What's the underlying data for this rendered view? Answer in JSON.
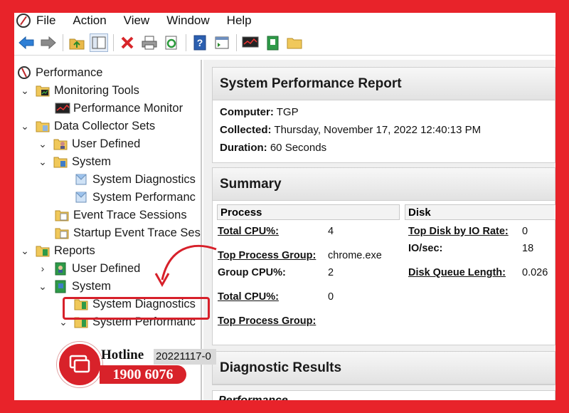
{
  "menu": [
    "File",
    "Action",
    "View",
    "Window",
    "Help"
  ],
  "toolbar": [
    "back-icon",
    "forward-icon",
    "up-folder-icon",
    "show-hide-tree-icon",
    "delete-icon",
    "print-icon",
    "refresh-icon",
    "help-icon",
    "properties-icon",
    "monitor-icon",
    "book-icon",
    "folder-icon"
  ],
  "tree": {
    "items": [
      {
        "label": "Performance"
      },
      {
        "label": "Monitoring Tools"
      },
      {
        "label": "Performance Monitor"
      },
      {
        "label": "Data Collector Sets"
      },
      {
        "label": "User Defined"
      },
      {
        "label": "System"
      },
      {
        "label": "System Diagnostics"
      },
      {
        "label": "System Performanc"
      },
      {
        "label": "Event Trace Sessions"
      },
      {
        "label": "Startup Event Trace Ses"
      },
      {
        "label": "Reports"
      },
      {
        "label": "User Defined"
      },
      {
        "label": "System"
      },
      {
        "label": "System Diagnostics"
      },
      {
        "label": "System Performanc"
      },
      {
        "label": "20221117-0"
      }
    ]
  },
  "report": {
    "title": "System Performance Report",
    "computer_label": "Computer:",
    "computer_value": "TGP",
    "collected_label": "Collected:",
    "collected_value": "Thursday, November 17, 2022 12:40:13 PM",
    "duration_label": "Duration:",
    "duration_value": "60 Seconds"
  },
  "summary": {
    "title": "Summary",
    "process_header": "Process",
    "disk_header": "Disk",
    "process_rows": [
      {
        "label": "Total CPU%:",
        "value": "4"
      },
      {
        "label": "Top Process Group:",
        "value": "chrome.exe"
      },
      {
        "label": "Group CPU%:",
        "value": "2"
      },
      {
        "label": "Total CPU%:",
        "value": "0"
      },
      {
        "label": "Top Process Group:",
        "value": ""
      }
    ],
    "disk_rows": [
      {
        "label": "Top Disk by IO Rate:",
        "value": "0"
      },
      {
        "label": "IO/sec:",
        "value": "18"
      },
      {
        "label": "Disk Queue Length:",
        "value": "0.026"
      }
    ]
  },
  "diagnostic": {
    "title": "Diagnostic Results",
    "subtitle": "Performance"
  },
  "hotline": {
    "label": "Hotline",
    "number": "1900 6076"
  }
}
